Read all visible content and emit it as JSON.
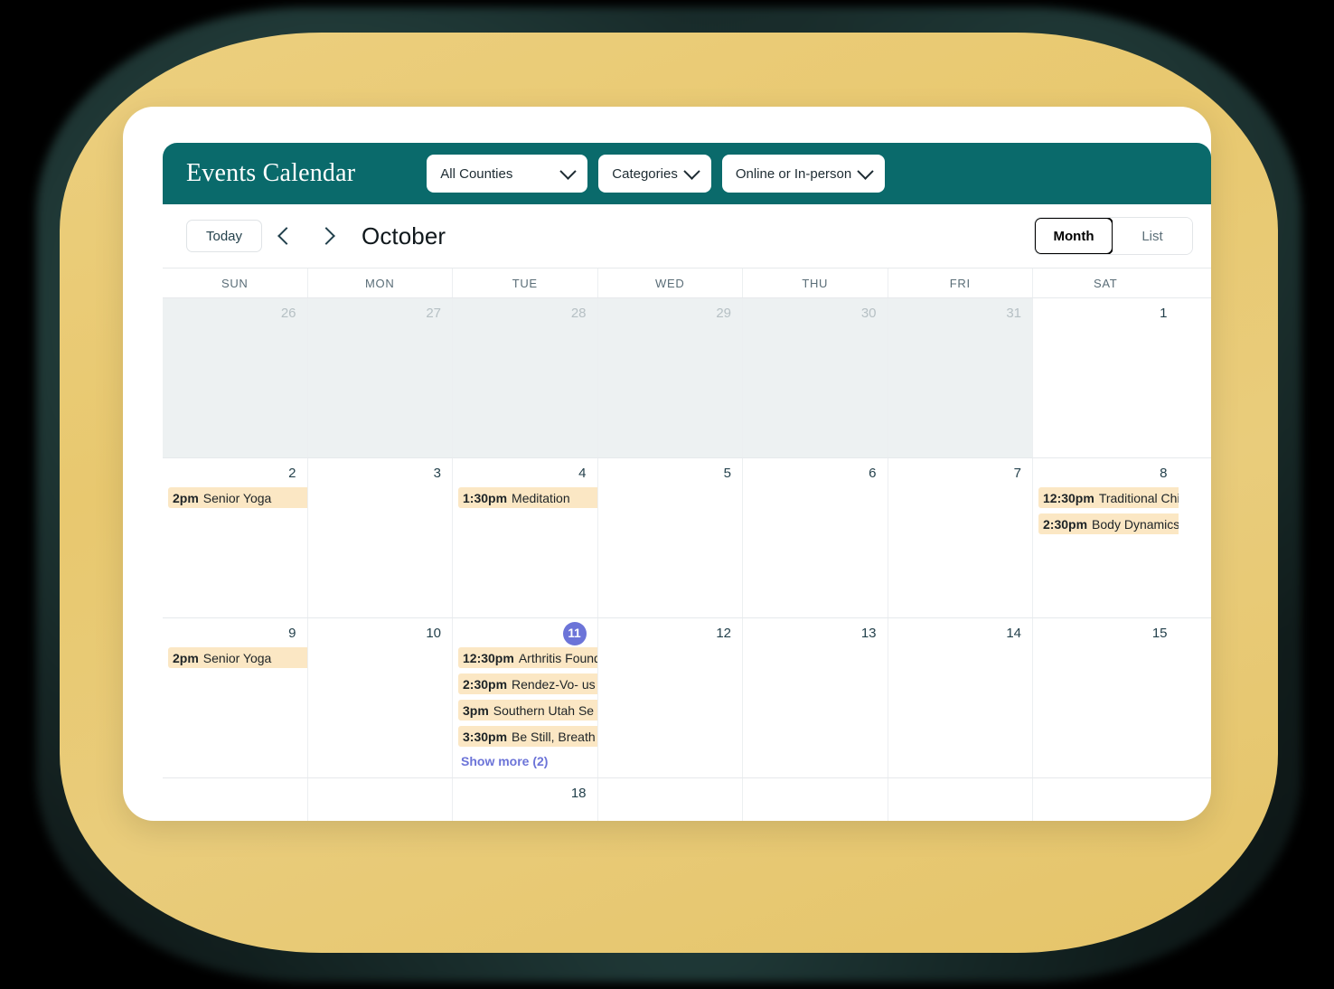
{
  "app": {
    "title": "Events Calendar",
    "header_color": "#0a6a6b",
    "accent_color": "#6c74d8",
    "event_chip_color": "#fbe7c4",
    "page_background": "#000000",
    "blob_color": "#e8c86f"
  },
  "filters": [
    {
      "label": "All Counties",
      "icon": "chevron-down-icon",
      "width": "wide"
    },
    {
      "label": "Categories",
      "icon": "chevron-down-icon",
      "width": "snug"
    },
    {
      "label": "Online or In-person",
      "icon": "chevron-down-icon",
      "width": "snug"
    }
  ],
  "toolbar": {
    "today_label": "Today",
    "prev_icon": "chevron-left-icon",
    "next_icon": "chevron-right-icon",
    "month_label": "October",
    "views": [
      {
        "label": "Month",
        "active": true
      },
      {
        "label": "List",
        "active": false
      }
    ]
  },
  "calendar": {
    "day_headers": [
      "SUN",
      "MON",
      "TUE",
      "WED",
      "THU",
      "FRI",
      "SAT"
    ],
    "show_more_label": "Show more (2)",
    "weeks": [
      {
        "days": [
          {
            "num": "26",
            "out_of_month": true,
            "events": []
          },
          {
            "num": "27",
            "out_of_month": true,
            "events": []
          },
          {
            "num": "28",
            "out_of_month": true,
            "events": []
          },
          {
            "num": "29",
            "out_of_month": true,
            "events": []
          },
          {
            "num": "30",
            "out_of_month": true,
            "events": []
          },
          {
            "num": "31",
            "out_of_month": true,
            "events": []
          },
          {
            "num": "1",
            "out_of_month": false,
            "events": []
          }
        ]
      },
      {
        "days": [
          {
            "num": "2",
            "out_of_month": false,
            "events": [
              {
                "time": "2pm",
                "title": "Senior Yoga"
              }
            ]
          },
          {
            "num": "3",
            "out_of_month": false,
            "events": []
          },
          {
            "num": "4",
            "out_of_month": false,
            "events": [
              {
                "time": "1:30pm",
                "title": "Meditation"
              }
            ]
          },
          {
            "num": "5",
            "out_of_month": false,
            "events": []
          },
          {
            "num": "6",
            "out_of_month": false,
            "events": []
          },
          {
            "num": "7",
            "out_of_month": false,
            "events": []
          },
          {
            "num": "8",
            "out_of_month": false,
            "events": [
              {
                "time": "12:30pm",
                "title": "Traditional Chi"
              },
              {
                "time": "2:30pm",
                "title": "Body Dynamics"
              }
            ]
          }
        ]
      },
      {
        "days": [
          {
            "num": "9",
            "out_of_month": false,
            "events": [
              {
                "time": "2pm",
                "title": "Senior Yoga"
              }
            ]
          },
          {
            "num": "10",
            "out_of_month": false,
            "events": []
          },
          {
            "num": "11",
            "out_of_month": false,
            "today": true,
            "show_more": true,
            "events": [
              {
                "time": "12:30pm",
                "title": "Arthritis Found"
              },
              {
                "time": "2:30pm",
                "title": "Rendez-Vo- us"
              },
              {
                "time": "3pm",
                "title": "Southern Utah Se"
              },
              {
                "time": "3:30pm",
                "title": "Be Still, Breath"
              }
            ]
          },
          {
            "num": "12",
            "out_of_month": false,
            "events": []
          },
          {
            "num": "13",
            "out_of_month": false,
            "events": []
          },
          {
            "num": "14",
            "out_of_month": false,
            "events": []
          },
          {
            "num": "15",
            "out_of_month": false,
            "events": []
          }
        ]
      },
      {
        "partial": true,
        "days": [
          {
            "num": "",
            "out_of_month": false,
            "events": []
          },
          {
            "num": "",
            "out_of_month": false,
            "events": []
          },
          {
            "num": "18",
            "out_of_month": false,
            "events": []
          },
          {
            "num": "",
            "out_of_month": false,
            "events": []
          },
          {
            "num": "",
            "out_of_month": false,
            "events": []
          },
          {
            "num": "",
            "out_of_month": false,
            "events": []
          },
          {
            "num": "",
            "out_of_month": false,
            "events": []
          }
        ]
      }
    ]
  }
}
